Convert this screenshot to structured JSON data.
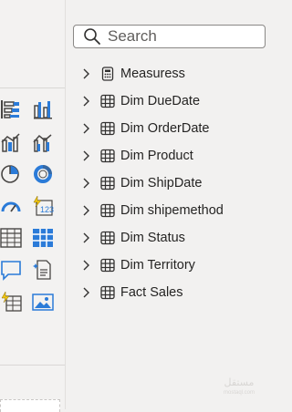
{
  "search": {
    "placeholder": "Search"
  },
  "fields": [
    {
      "label": "Measuress",
      "icon": "calculator-icon"
    },
    {
      "label": "Dim DueDate",
      "icon": "table-icon"
    },
    {
      "label": "Dim OrderDate",
      "icon": "table-icon"
    },
    {
      "label": "Dim Product",
      "icon": "table-icon"
    },
    {
      "label": "Dim ShipDate",
      "icon": "table-icon"
    },
    {
      "label": "Dim shipemethod",
      "icon": "table-icon"
    },
    {
      "label": "Dim Status",
      "icon": "table-icon"
    },
    {
      "label": "Dim Territory",
      "icon": "table-icon"
    },
    {
      "label": "Fact Sales",
      "icon": "table-icon"
    }
  ],
  "visualizations": [
    "stacked-bar-chart-icon",
    "clustered-column-chart-icon",
    "line-and-stacked-column-icon",
    "line-and-clustered-column-icon",
    "pie-chart-icon",
    "donut-chart-icon",
    "gauge-icon",
    "card-icon",
    "table-visual-icon",
    "matrix-icon",
    "qa-icon",
    "smart-narrative-icon",
    "paginated-report-icon",
    "image-icon"
  ],
  "watermark": {
    "line1": "مستقل",
    "line2": "mostaql.com"
  },
  "colors": {
    "accent": "#2b7bd8",
    "icon_gray": "#484644",
    "panel_bg": "#f3f2f1",
    "highlight": "#f2c811"
  }
}
